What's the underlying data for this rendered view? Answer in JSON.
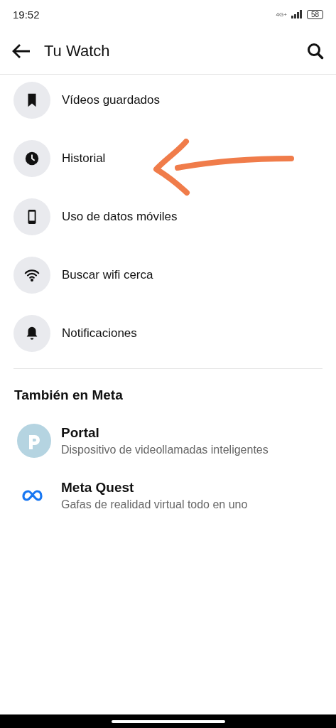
{
  "status_bar": {
    "time": "19:52",
    "network": "4G+",
    "battery": "58"
  },
  "header": {
    "title": "Tu Watch"
  },
  "menu_items": [
    {
      "label": "Vídeos guardados"
    },
    {
      "label": "Historial"
    },
    {
      "label": "Uso de datos móviles"
    },
    {
      "label": "Buscar wifi cerca"
    },
    {
      "label": "Notificaciones"
    }
  ],
  "section": {
    "title": "También en Meta"
  },
  "apps": [
    {
      "name": "Portal",
      "description": "Dispositivo de videollamadas inteligentes"
    },
    {
      "name": "Meta Quest",
      "description": "Gafas de realidad virtual todo en uno"
    }
  ]
}
